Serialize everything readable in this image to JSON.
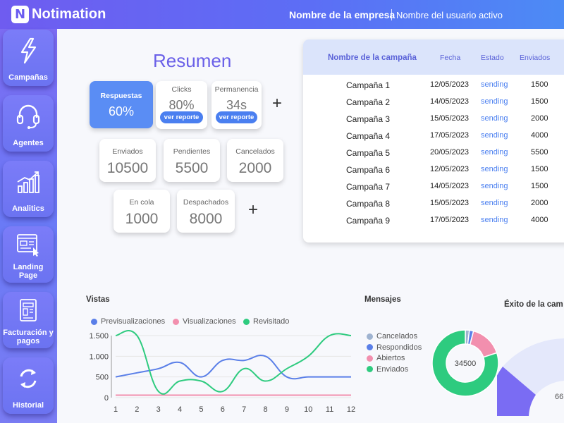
{
  "header": {
    "logo_letter": "N",
    "app_name": "Notimation",
    "company": "Nombre de la empresa",
    "user": "Nombre del usuario activo"
  },
  "sidebar": {
    "items": [
      {
        "label": "Campañas",
        "icon": "lightning-icon"
      },
      {
        "label": "Agentes",
        "icon": "headset-icon"
      },
      {
        "label": "Analitics",
        "icon": "bar-chart-icon"
      },
      {
        "label": "Landing Page",
        "icon": "webpage-icon"
      },
      {
        "label": "Facturación y pagos",
        "icon": "invoice-icon"
      },
      {
        "label": "Historial",
        "icon": "refresh-icon"
      }
    ]
  },
  "resumen": {
    "title": "Resumen",
    "respuestas": {
      "label": "Respuestas",
      "value": "60%"
    },
    "clicks": {
      "label": "Clicks",
      "value": "80%",
      "button": "ver reporte"
    },
    "permanencia": {
      "label": "Permanencia",
      "value": "34s",
      "button": "ver reporte"
    },
    "enviados": {
      "label": "Enviados",
      "value": "10500"
    },
    "pendientes": {
      "label": "Pendientes",
      "value": "5500"
    },
    "cancelados": {
      "label": "Cancelados",
      "value": "2000"
    },
    "en_cola": {
      "label": "En cola",
      "value": "1000"
    },
    "despachados": {
      "label": "Despachados",
      "value": "8000"
    }
  },
  "campaign_table": {
    "headers": {
      "name": "Nombre de la campaña",
      "date": "Fecha",
      "state": "Estado",
      "sent": "Enviados"
    },
    "rows": [
      {
        "name": "Campaña 1",
        "date": "12/05/2023",
        "state": "sending",
        "sent": "1500"
      },
      {
        "name": "Campaña 2",
        "date": "14/05/2023",
        "state": "sending",
        "sent": "1500"
      },
      {
        "name": "Campaña 3",
        "date": "15/05/2023",
        "state": "sending",
        "sent": "2000"
      },
      {
        "name": "Campaña 4",
        "date": "17/05/2023",
        "state": "sending",
        "sent": "4000"
      },
      {
        "name": "Campaña 5",
        "date": "20/05/2023",
        "state": "sending",
        "sent": "5500"
      },
      {
        "name": "Campaña 6",
        "date": "12/05/2023",
        "state": "sending",
        "sent": "1500"
      },
      {
        "name": "Campaña 7",
        "date": "14/05/2023",
        "state": "sending",
        "sent": "1500"
      },
      {
        "name": "Campaña 8",
        "date": "15/05/2023",
        "state": "sending",
        "sent": "2000"
      },
      {
        "name": "Campaña 9",
        "date": "17/05/2023",
        "state": "sending",
        "sent": "4000"
      }
    ]
  },
  "vistas": {
    "title": "Vistas"
  },
  "mensajes": {
    "title": "Mensajes",
    "center_label": "34500"
  },
  "exito": {
    "title": "Éxito de la cam",
    "value_fragment": "66"
  },
  "colors": {
    "accent": "#6a60e8",
    "blue": "#5a7fe8",
    "pink": "#f28fae",
    "green": "#2ecb7f",
    "grey": "#9fb3d0"
  },
  "chart_data": [
    {
      "type": "line",
      "title": "Vistas",
      "x": [
        1,
        2,
        3,
        4,
        5,
        6,
        7,
        8,
        9,
        10,
        11,
        12
      ],
      "ylim": [
        0,
        1500
      ],
      "yticks": [
        "0",
        "500",
        "1.000",
        "1.500"
      ],
      "series": [
        {
          "name": "Previsualizaciones",
          "color": "#5a7fe8",
          "values": [
            500,
            600,
            700,
            850,
            500,
            900,
            900,
            1000,
            500,
            500,
            500,
            500
          ]
        },
        {
          "name": "Visualizaciones",
          "color": "#f28fae",
          "values": [
            60,
            60,
            60,
            60,
            60,
            60,
            60,
            60,
            60,
            60,
            60,
            60
          ]
        },
        {
          "name": "Revisitado",
          "color": "#2ecb7f",
          "values": [
            1500,
            1500,
            150,
            400,
            400,
            150,
            700,
            400,
            700,
            1000,
            1500,
            1500
          ]
        }
      ]
    },
    {
      "type": "pie",
      "title": "Mensajes",
      "center_label": "34500",
      "categories": [
        "Cancelados",
        "Respondidos",
        "Abiertos",
        "Enviados"
      ],
      "values": [
        2,
        2,
        16,
        80
      ],
      "colors": [
        "#9fb3d0",
        "#5a7fe8",
        "#f28fae",
        "#2ecb7f"
      ]
    }
  ]
}
